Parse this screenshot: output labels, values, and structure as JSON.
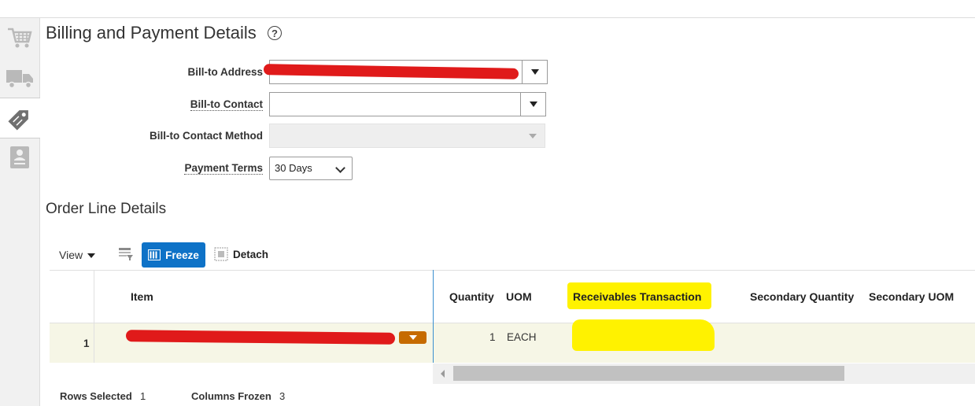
{
  "sidebar": {
    "tabs": [
      {
        "icon": "shopping-cart-icon"
      },
      {
        "icon": "truck-icon"
      },
      {
        "icon": "price-tag-icon"
      },
      {
        "icon": "document-person-icon"
      }
    ]
  },
  "billing": {
    "title": "Billing and Payment Details",
    "help_glyph": "?",
    "fields": {
      "bill_to_address": {
        "label": "Bill-to Address",
        "value": ""
      },
      "bill_to_contact": {
        "label": "Bill-to Contact",
        "value": ""
      },
      "bill_to_contact_method": {
        "label": "Bill-to Contact Method",
        "value": ""
      },
      "payment_terms": {
        "label": "Payment Terms",
        "value": "30 Days"
      }
    }
  },
  "order_lines": {
    "title": "Order Line Details",
    "toolbar": {
      "view_label": "View",
      "freeze_label": "Freeze",
      "detach_label": "Detach"
    },
    "columns": {
      "item": "Item",
      "quantity": "Quantity",
      "uom": "UOM",
      "receivables_transaction": "Receivables Transaction",
      "secondary_quantity": "Secondary Quantity",
      "secondary_uom": "Secondary UOM"
    },
    "rows": [
      {
        "line_number": "1",
        "quantity": "1",
        "uom": "EACH"
      }
    ],
    "footer": {
      "rows_selected_label": "Rows Selected",
      "rows_selected_value": "1",
      "columns_frozen_label": "Columns Frozen",
      "columns_frozen_value": "3"
    }
  },
  "colors": {
    "accent": "#0e72c7",
    "row_highlight": "#f6f6e6",
    "redaction_red": "#e01a1a",
    "highlight_yellow": "#fff200",
    "row_menu": "#c66b00"
  }
}
